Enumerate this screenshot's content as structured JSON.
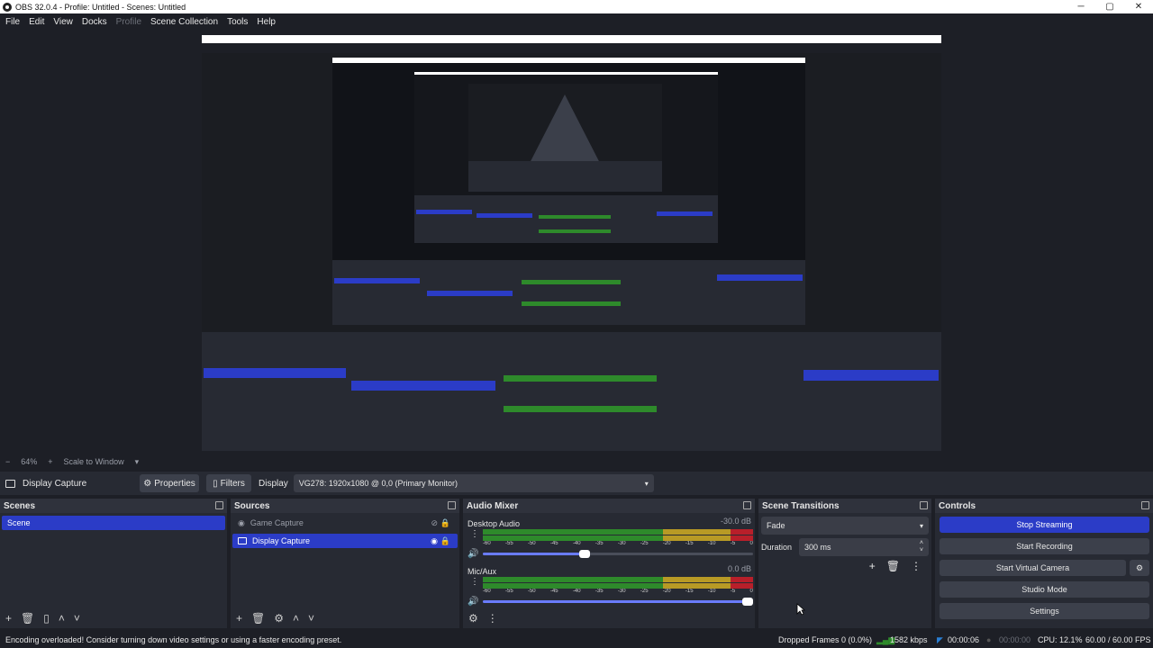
{
  "window": {
    "title": "OBS 32.0.4 - Profile: Untitled - Scenes: Untitled",
    "minimize": "─",
    "maximize": "▢",
    "close": "✕"
  },
  "menu": [
    "File",
    "Edit",
    "View",
    "Docks",
    "Profile",
    "Scene Collection",
    "Tools",
    "Help"
  ],
  "zoom": {
    "minus": "−",
    "level": "64%",
    "plus": "+",
    "mode": "Scale to Window",
    "chevron": "▾"
  },
  "source_toolbar": {
    "source_name": "Display Capture",
    "properties_label": "Properties",
    "filters_label": "Filters",
    "display_label": "Display",
    "display_value": "VG278: 1920x1080 @ 0,0 (Primary Monitor)"
  },
  "scenes": {
    "title": "Scenes",
    "items": [
      "Scene"
    ],
    "footer_icons": [
      "add-icon",
      "trash-icon",
      "filter-icon",
      "arrow-up-icon",
      "arrow-down-icon"
    ]
  },
  "sources": {
    "title": "Sources",
    "items": [
      {
        "name": "Game Capture",
        "visible": false,
        "locked": true
      },
      {
        "name": "Display Capture",
        "visible": true,
        "locked": true
      }
    ]
  },
  "audio_mixer": {
    "title": "Audio Mixer",
    "channels": [
      {
        "name": "Desktop Audio",
        "db": "-30.0 dB",
        "volume": 0.37
      },
      {
        "name": "Mic/Aux",
        "db": "0.0 dB",
        "volume": 1.0
      }
    ],
    "ticks": [
      "-60",
      "-55",
      "-50",
      "-45",
      "-40",
      "-35",
      "-30",
      "-25",
      "-20",
      "-15",
      "-10",
      "-5",
      "0"
    ]
  },
  "scene_transitions": {
    "title": "Scene Transitions",
    "transition": "Fade",
    "duration_label": "Duration",
    "duration_value": "300 ms"
  },
  "controls": {
    "title": "Controls",
    "stop_streaming": "Stop Streaming",
    "start_recording": "Start Recording",
    "start_virtual_camera": "Start Virtual Camera",
    "studio_mode": "Studio Mode",
    "settings": "Settings"
  },
  "status": {
    "message": "Encoding overloaded! Consider turning down video settings or using a faster encoding preset.",
    "dropped_frames": "Dropped Frames 0 (0.0%)",
    "bitrate": "1582 kbps",
    "stream_time": "00:00:06",
    "record_time": "00:00:00",
    "cpu": "CPU: 12.1%",
    "fps": "60.00 / 60.00 FPS"
  },
  "colors": {
    "accent": "#2b3cc7",
    "bg": "#1d1f26",
    "panel": "#272a33",
    "meter_green": "#2e8a2b",
    "meter_yellow": "#b89a25",
    "meter_red": "#b81f2a",
    "live": "#2a7fd4"
  }
}
